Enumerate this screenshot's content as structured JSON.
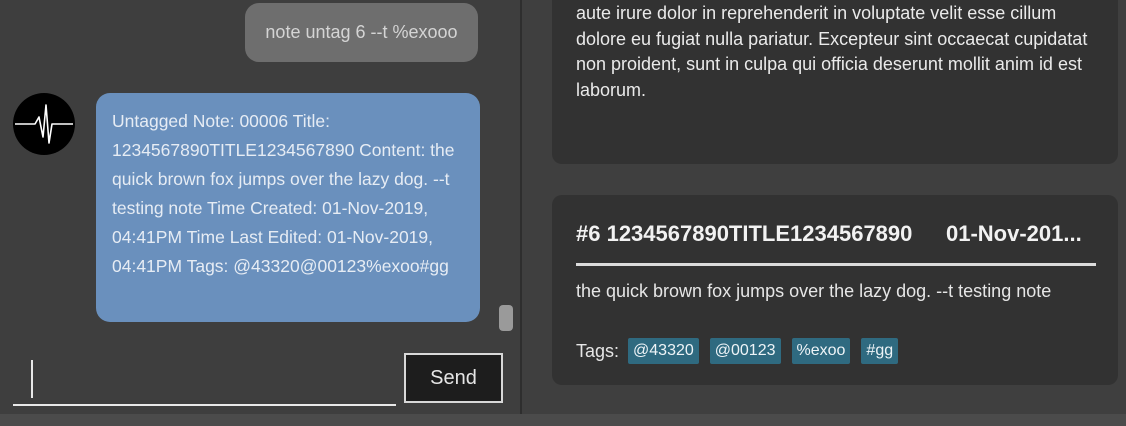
{
  "chat": {
    "user_message": "note untag 6 --t %exooo",
    "bot_message": "Untagged Note: 00006 Title: 1234567890TITLE1234567890 Content: the quick brown fox jumps over the lazy dog. --t testing note Time Created: 01-Nov-2019, 04:41PM Time Last Edited: 01-Nov-2019, 04:41PM Tags: @43320@00123%exoo#gg",
    "input_value": "",
    "send_label": "Send",
    "avatar_icon": "heartbeat-icon"
  },
  "notes": {
    "card1_text": "aliqua. Ut enim ad minim veniam, quis nostrud exercitation ullamco laboris nisi ut aliquipex ea commodo consequat. Duis aute irure dolor in reprehenderit in voluptate velit esse cillum dolore eu fugiat nulla pariatur. Excepteur sint occaecat cupidatat non proident, sunt in culpa qui officia deserunt mollit anim id est laborum.",
    "card2": {
      "title": "#6 1234567890TITLE1234567890",
      "date": "01-Nov-201...",
      "content": "the quick brown fox jumps over the lazy dog. --t testing note",
      "tags_label": "Tags:",
      "tags": [
        "@43320",
        "@00123",
        "%exoo",
        "#gg"
      ]
    }
  },
  "colors": {
    "bot_bubble": "#6a90bd",
    "user_bubble": "#6e6e6e",
    "tag_bg": "#2f6a80"
  }
}
